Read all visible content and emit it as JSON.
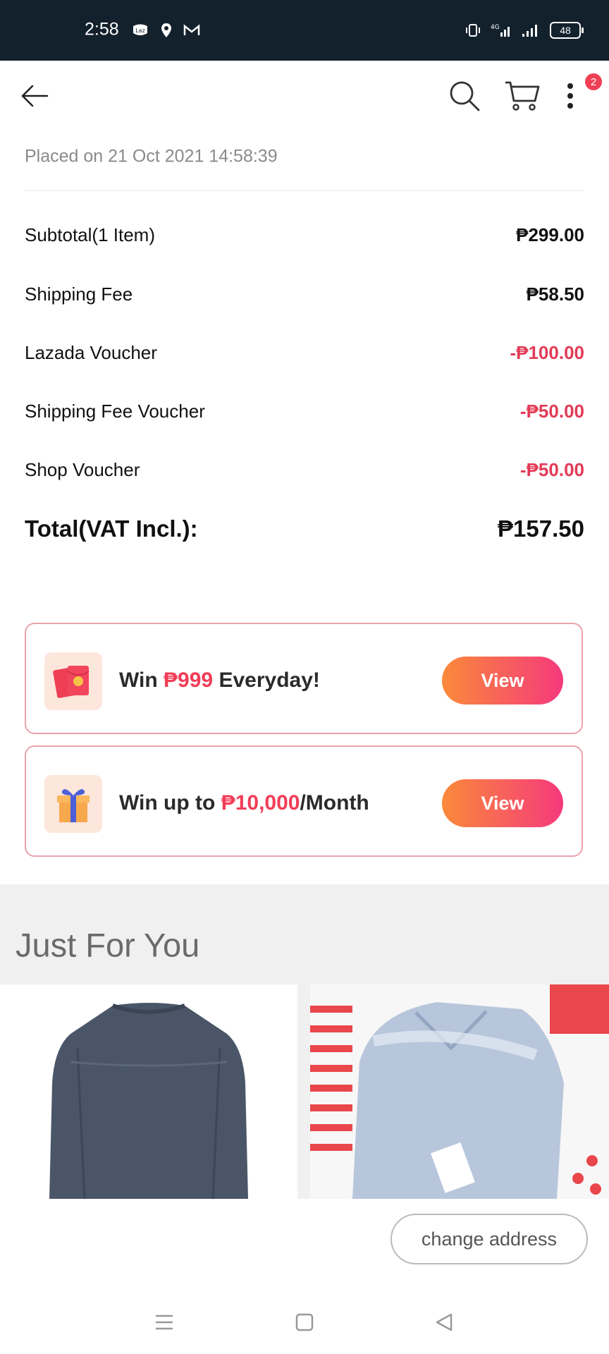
{
  "status_bar": {
    "time": "2:58",
    "battery": "48",
    "network": "4G"
  },
  "top_nav": {
    "menu_badge": "2"
  },
  "order": {
    "placed_on": "Placed on 21 Oct 2021  14:58:39",
    "rows": [
      {
        "label": "Subtotal(1 Item)",
        "value": "₱299.00"
      },
      {
        "label": "Shipping Fee",
        "value": "₱58.50"
      },
      {
        "label": "Lazada Voucher",
        "value": "-₱100.00"
      },
      {
        "label": "Shipping Fee Voucher",
        "value": "-₱50.00"
      },
      {
        "label": "Shop Voucher",
        "value": "-₱50.00"
      }
    ],
    "total_label": "Total(VAT Incl.):",
    "total_value": "₱157.50"
  },
  "promos": [
    {
      "prefix": "Win ",
      "highlight": "₱999",
      "suffix": " Everyday!",
      "button": "View",
      "icon": "red-envelope-icon"
    },
    {
      "prefix": "Win up to ",
      "highlight": "₱10,000",
      "suffix": "/Month",
      "button": "View",
      "icon": "gift-box-icon"
    }
  ],
  "just_for_you": {
    "title": "Just For You",
    "products": [
      {
        "image": "sweater-image"
      },
      {
        "image": "shirt-image"
      }
    ]
  },
  "change_address_label": "change address",
  "colors": {
    "accent": "#e23b56",
    "button_gradient_start": "#fb8a3a",
    "button_gradient_end": "#f5397c",
    "status_bar": "#13212d"
  }
}
